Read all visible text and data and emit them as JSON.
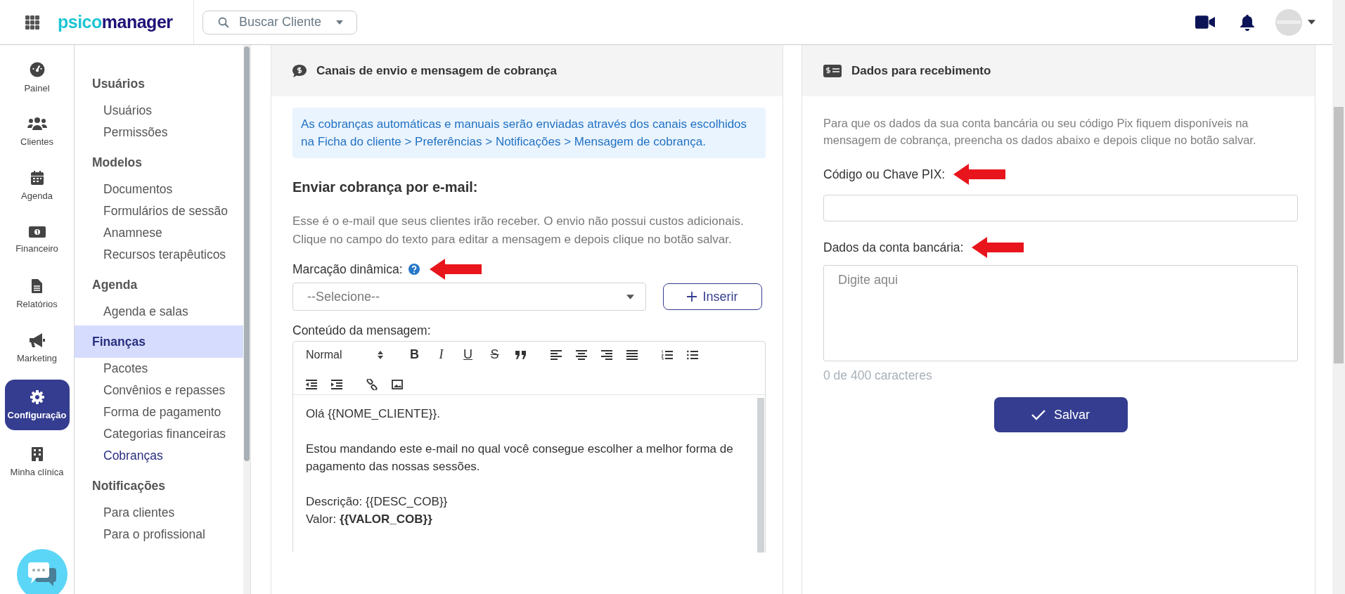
{
  "topbar": {
    "logo": [
      "psico",
      "manager"
    ],
    "search": {
      "placeholder": "Buscar Cliente"
    }
  },
  "nav_rail": [
    {
      "kind": "dashboard",
      "label": "Painel",
      "selected": false
    },
    {
      "kind": "users",
      "label": "Clientes",
      "selected": false
    },
    {
      "kind": "calendar",
      "label": "Agenda",
      "selected": false
    },
    {
      "kind": "money",
      "label": "Financeiro",
      "selected": false
    },
    {
      "kind": "file",
      "label": "Relatórios",
      "selected": false
    },
    {
      "kind": "megaphone",
      "label": "Marketing",
      "selected": false
    },
    {
      "kind": "gear",
      "label": "Configuração",
      "selected": true
    },
    {
      "kind": "building",
      "label": "Minha clínica",
      "selected": false
    }
  ],
  "settings_menu": [
    {
      "heading": "Usuários",
      "selected": false,
      "items": [
        {
          "label": "Usuários",
          "selected": false
        },
        {
          "label": "Permissões",
          "selected": false
        }
      ]
    },
    {
      "heading": "Modelos",
      "selected": false,
      "items": [
        {
          "label": "Documentos",
          "selected": false
        },
        {
          "label": "Formulários de sessão",
          "selected": false
        },
        {
          "label": "Anamnese",
          "selected": false
        },
        {
          "label": "Recursos terapêuticos",
          "selected": false
        }
      ]
    },
    {
      "heading": "Agenda",
      "selected": false,
      "items": [
        {
          "label": "Agenda e salas",
          "selected": false
        }
      ]
    },
    {
      "heading": "Finanças",
      "selected": true,
      "items": [
        {
          "label": "Pacotes",
          "selected": false
        },
        {
          "label": "Convênios e repasses",
          "selected": false
        },
        {
          "label": "Forma de pagamento",
          "selected": false
        },
        {
          "label": "Categorias financeiras",
          "selected": false
        },
        {
          "label": "Cobranças",
          "selected": true
        }
      ]
    },
    {
      "heading": "Notificações",
      "selected": false,
      "items": [
        {
          "label": "Para clientes",
          "selected": false
        },
        {
          "label": "Para o profissional",
          "selected": false
        }
      ]
    }
  ],
  "billing_panel": {
    "title": "Canais de envio e mensagem de cobrança",
    "notice": "As cobranças automáticas e manuais serão enviadas através dos canais escolhidos na Ficha do cliente > Preferências > Notificações > Mensagem de cobrança.",
    "email_heading": "Enviar cobrança por e-mail:",
    "email_description": "Esse é o e-mail que seus clientes irão receber. O envio não possui custos adicionais. Clique no campo do texto para editar a mensagem e depois clique no botão salvar.",
    "dynamic_tag_label": "Marcação dinâmica:",
    "dynamic_tag_select": {
      "value": "--Selecione--"
    },
    "insert_button": "Inserir",
    "content_label": "Conteúdo da mensagem:",
    "editor": {
      "format": "Normal",
      "toolbar": [
        [
          {
            "kind": "bold",
            "label": "B"
          },
          {
            "kind": "italic",
            "label": "I"
          },
          {
            "kind": "underline",
            "label": "U"
          },
          {
            "kind": "strike",
            "label": "S"
          },
          {
            "kind": "quote"
          }
        ],
        [
          {
            "kind": "align-left"
          },
          {
            "kind": "align-center"
          },
          {
            "kind": "align-right"
          },
          {
            "kind": "justify"
          }
        ],
        [
          {
            "kind": "ordered-list"
          },
          {
            "kind": "bullet-list"
          }
        ],
        [
          {
            "kind": "outdent"
          },
          {
            "kind": "indent"
          }
        ],
        [
          {
            "kind": "link"
          },
          {
            "kind": "image"
          }
        ]
      ],
      "paragraphs": [
        [
          "Olá {{NOME_CLIENTE}}."
        ],
        [
          "Estou mandando este e-mail no qual você consegue escolher a melhor forma de pagamento das nossas sessões."
        ],
        [
          "Descrição: {{DESC_COB}}",
          "Valor: **{{VALOR_COB}}**"
        ]
      ]
    }
  },
  "payment_panel": {
    "title": "Dados para recebimento",
    "description": "Para que os dados da sua conta bancária ou seu código Pix fiquem disponíveis na mensagem de cobrança, preencha os dados abaixo e depois clique no botão salvar.",
    "pix_label": "Código ou Chave PIX:",
    "bank_label": "Dados da conta bancária:",
    "bank_placeholder": "Digite aqui",
    "counter": "0 de 400 caracteres",
    "save_button": "Salvar"
  }
}
